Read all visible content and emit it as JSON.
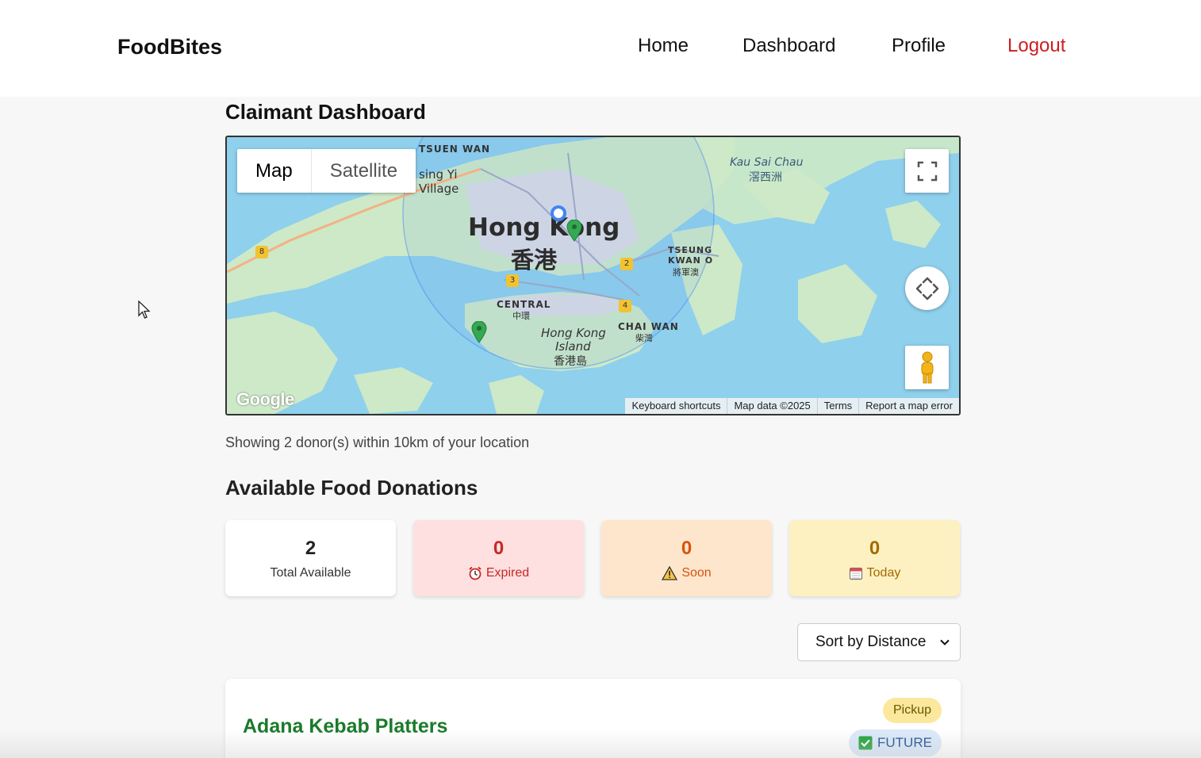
{
  "nav": {
    "brand": "FoodBites",
    "home": "Home",
    "dashboard": "Dashboard",
    "profile": "Profile",
    "logout": "Logout"
  },
  "page": {
    "title": "Claimant Dashboard"
  },
  "map": {
    "type_map": "Map",
    "type_satellite": "Satellite",
    "labels": {
      "hong_kong": "Hong Kong",
      "hong_kong_cn": "香港",
      "kau_sai_chau": "Kau Sai Chau",
      "kau_sai_chau_cn": "滘西洲",
      "tsuen_wan": "TSUEN WAN",
      "tsing_yi": "sing Yi",
      "village": "Village",
      "central": "CENTRAL",
      "central_cn": "中環",
      "hk_island_1": "Hong Kong",
      "hk_island_2": "Island",
      "hk_island_cn": "香港島",
      "chai_wan": "CHAI WAN",
      "chai_wan_cn": "柴灣",
      "tseung_kwan_o_1": "TSEUNG",
      "tseung_kwan_o_2": "KWAN O",
      "tseung_kwan_o_cn": "將軍澳",
      "route_8": "8",
      "route_3": "3",
      "route_2": "2",
      "route_4": "4"
    },
    "google": "Google",
    "attribution": {
      "shortcuts": "Keyboard shortcuts",
      "data": "Map data ©2025",
      "terms": "Terms",
      "report": "Report a map error"
    },
    "icons": [
      "fullscreen-icon",
      "recenter-icon",
      "pegman-icon",
      "user-location-marker",
      "donor-marker"
    ]
  },
  "summary_text": "Showing 2 donor(s) within 10km of your location",
  "section_title": "Available Food Donations",
  "stats": {
    "total": {
      "value": "2",
      "label": "Total Available"
    },
    "expired": {
      "value": "0",
      "label": "Expired",
      "icon": "alarm-clock-icon"
    },
    "soon": {
      "value": "0",
      "label": "Soon",
      "icon": "warning-icon"
    },
    "today": {
      "value": "0",
      "label": "Today",
      "icon": "calendar-icon"
    }
  },
  "sort": {
    "selected": "Sort by Distance"
  },
  "listing": {
    "title": "Adana Kebab Platters",
    "type_badge": "Pickup",
    "status_badge": "FUTURE"
  },
  "colors": {
    "logout": "#cc1f1f",
    "expired": "#c62828",
    "soon": "#d9530f",
    "today": "#a46a00",
    "listing_title": "#1b7a2b",
    "water": "#8fd0ec",
    "land": "#cde9c8"
  }
}
